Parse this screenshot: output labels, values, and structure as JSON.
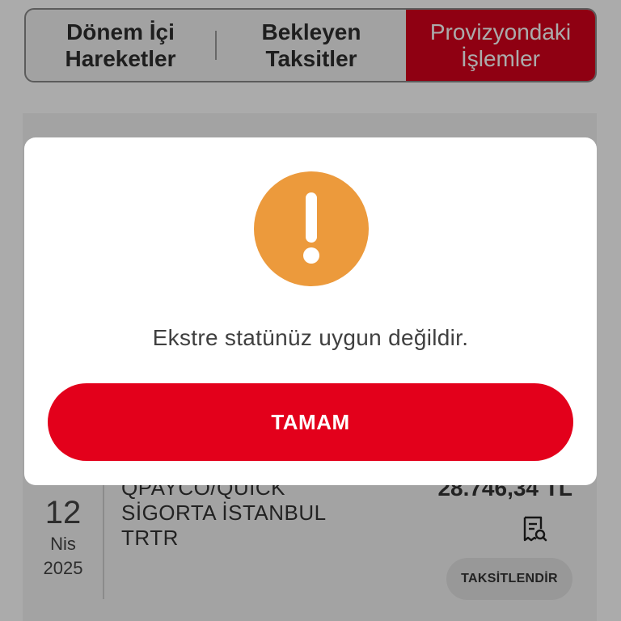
{
  "tabs": [
    {
      "label": "Dönem İçi\nHareketler",
      "active": false
    },
    {
      "label": "Bekleyen\nTaksitler",
      "active": false
    },
    {
      "label": "Provizyondaki\nİşlemler",
      "active": true
    }
  ],
  "transaction": {
    "day": "12",
    "month": "Nis",
    "year": "2025",
    "description": "QPAYCO/QUICK\nSİGORTA   İSTANBUL\nTRTR",
    "amount": "28.746,34 TL",
    "receipt_icon": "receipt-search-icon",
    "installment_label": "TAKSİTLENDİR"
  },
  "modal": {
    "icon": "exclamation-icon",
    "icon_color": "#ec9a3c",
    "message": "Ekstre statünüz uygun değildir.",
    "ok_label": "TAMAM"
  },
  "colors": {
    "brand_red": "#e3001b",
    "active_tab": "#d6001c"
  }
}
